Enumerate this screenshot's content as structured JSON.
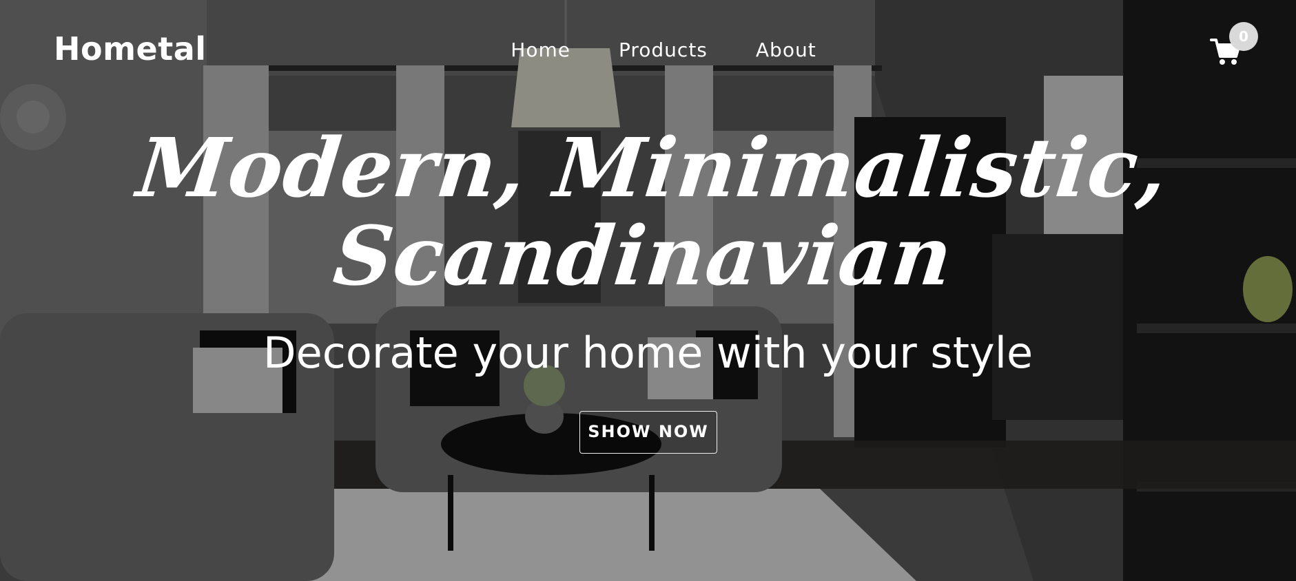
{
  "brand": {
    "name": "Hometal"
  },
  "nav": {
    "items": [
      {
        "label": "Home"
      },
      {
        "label": "Products"
      },
      {
        "label": "About"
      }
    ]
  },
  "cart": {
    "icon": "shopping-cart-icon",
    "count": "0"
  },
  "hero": {
    "headline_line1": "Modern, Minimalistic,",
    "headline_line2": "Scandinavian",
    "subheadline": "Decorate your home with your style",
    "cta_label": "SHOW NOW"
  },
  "colors": {
    "text": "#ffffff",
    "overlay": "rgba(0,0,0,0.35)",
    "badge": "#d9d9d9"
  }
}
